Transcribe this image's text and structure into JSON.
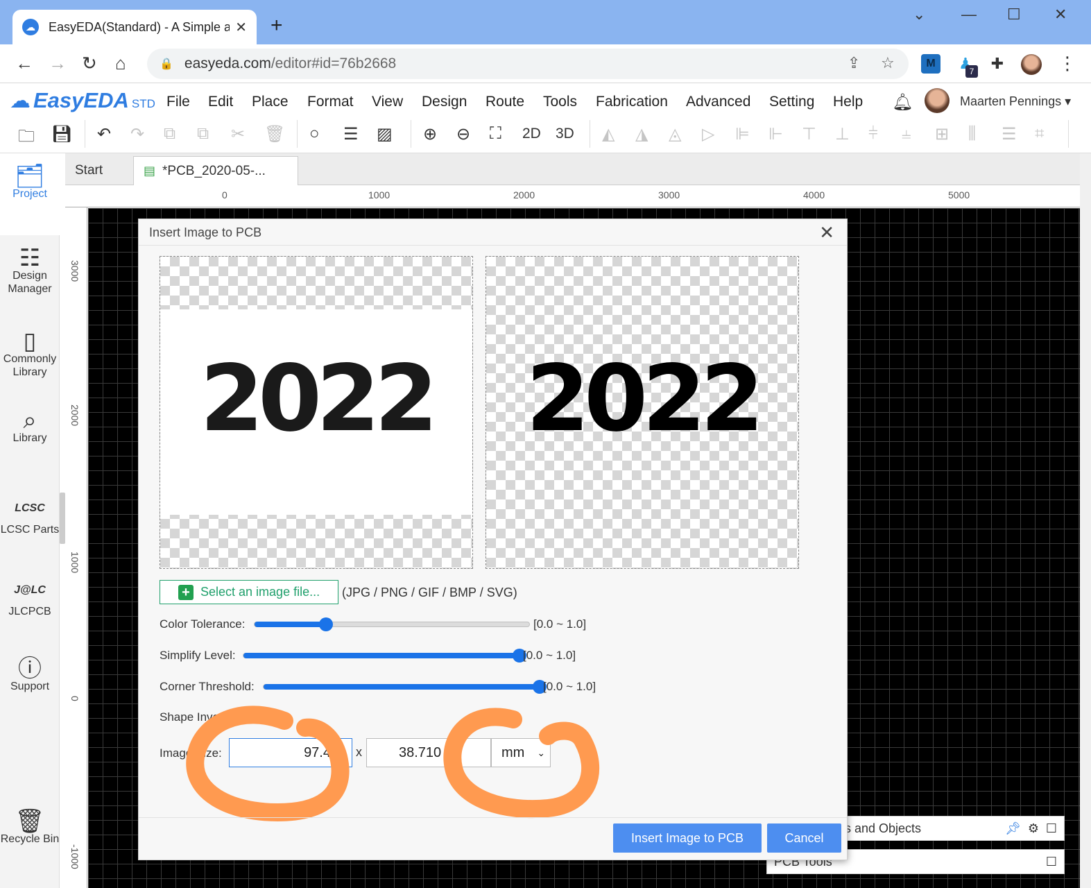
{
  "browser": {
    "tab_title": "EasyEDA(Standard) - A Simple and Powerful Electronic Circuit Design Tool",
    "url_host": "easyeda.com",
    "url_path": "/editor#id=76b2668",
    "extension_badge": "7",
    "extension_m": "M"
  },
  "app": {
    "logo_text": "EasyEDA",
    "logo_suffix": "STD",
    "menu": [
      "File",
      "Edit",
      "Place",
      "Format",
      "View",
      "Design",
      "Route",
      "Tools",
      "Fabrication",
      "Advanced",
      "Setting",
      "Help"
    ],
    "user_name": "Maarten Pennings",
    "toolbar_2d": "2D",
    "toolbar_3d": "3D"
  },
  "sidebar": {
    "items": [
      {
        "label": "Project",
        "icon": "folder-icon"
      },
      {
        "label": "Design Manager",
        "icon": "list-icon"
      },
      {
        "label": "Commonly Library",
        "icon": "chip-icon"
      },
      {
        "label": "Library",
        "icon": "search-chip-icon"
      },
      {
        "label": "LCSC Parts",
        "icon": "lcsc-icon",
        "logo": "LCSC"
      },
      {
        "label": "JLCPCB",
        "icon": "jlc-icon",
        "logo": "J@LC"
      },
      {
        "label": "Support",
        "icon": "help-icon"
      },
      {
        "label": "Recycle Bin",
        "icon": "trash-icon"
      }
    ]
  },
  "editor": {
    "tabs": [
      "Start",
      "*PCB_2020-05-..."
    ],
    "hruler_labels": [
      "0",
      "1000",
      "2000",
      "3000",
      "4000",
      "5000"
    ],
    "vruler_labels": [
      "3000",
      "2000",
      "1000",
      "0",
      "-1000"
    ],
    "panel_layers": "s and Objects",
    "panel_tools": "PCB Tools"
  },
  "dialog": {
    "title": "Insert Image to PCB",
    "preview_text": "2022",
    "select_file_label": "Select an image file...",
    "file_types": "(JPG / PNG / GIF / BMP / SVG)",
    "color_tolerance_label": "Color Tolerance:",
    "color_tolerance_value": 0.26,
    "simplify_level_label": "Simplify Level:",
    "simplify_level_value": 1.0,
    "corner_threshold_label": "Corner Threshold:",
    "corner_threshold_value": 1.0,
    "range_text": "[0.0 ~ 1.0]",
    "shape_invert_label": "Shape Invert:",
    "shape_invert_checked": false,
    "image_size_label": "Image Size:",
    "width_value": "97.4",
    "height_value": "38.710",
    "x_separator": "x",
    "unit_selected": "mm",
    "insert_button": "Insert Image to PCB",
    "cancel_button": "Cancel"
  },
  "colors": {
    "accent": "#2f7de1",
    "slider": "#1a73e8",
    "primary_button": "#4d8ef0",
    "annotation": "#ff9a50",
    "select_button_green": "#20a06c"
  }
}
